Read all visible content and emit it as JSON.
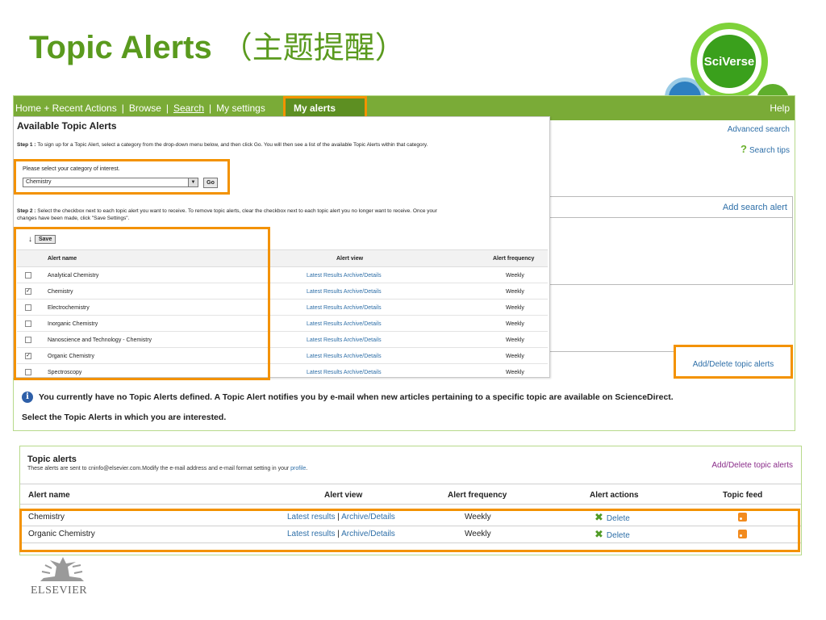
{
  "slide": {
    "title_en": "Topic Alerts",
    "title_cn": "（主题提醒）",
    "logo_text": "SciVerse",
    "publisher": "ELSEVIER"
  },
  "navbar": {
    "items": [
      "Home + Recent Actions",
      "Browse",
      "Search",
      "My settings"
    ],
    "active": "My alerts",
    "help": "Help"
  },
  "right_side": {
    "advanced_search": "Advanced search",
    "search_tips": "Search tips",
    "add_search_alert": "Add search alert",
    "add_delete_topic_alerts": "Add/Delete topic alerts"
  },
  "info": {
    "line1": "You currently have no Topic Alerts defined. A Topic Alert notifies you by e-mail when new articles pertaining to a specific topic are available on ScienceDirect.",
    "line2": "Select the Topic Alerts in which you are interested."
  },
  "panel": {
    "title": "Available Topic Alerts",
    "step1_label": "Step 1 :",
    "step1_text": "To sign up for a Topic Alert, select a category from the drop-down menu below, and then click Go. You will then see a list of the available Topic Alerts within that category.",
    "category_prompt": "Please select your category of interest.",
    "category_value": "Chemistry",
    "go": "Go",
    "step2_label": "Step 2 :",
    "step2_text": "Select the checkbox next to each topic alert you want to receive. To remove topic alerts, clear the checkbox next to each topic alert you no longer want to receive. Once your changes have been made, click \"Save Settings\".",
    "save": "Save",
    "columns": [
      "Alert name",
      "Alert view",
      "Alert frequency"
    ],
    "view_latest": "Latest Results",
    "view_archive": "Archive/Details",
    "rows": [
      {
        "name": "Analytical Chemistry",
        "checked": false,
        "freq": "Weekly"
      },
      {
        "name": "Chemistry",
        "checked": true,
        "freq": "Weekly"
      },
      {
        "name": "Electrochemistry",
        "checked": false,
        "freq": "Weekly"
      },
      {
        "name": "Inorganic Chemistry",
        "checked": false,
        "freq": "Weekly"
      },
      {
        "name": "Nanoscience and Technology - Chemistry",
        "checked": false,
        "freq": "Weekly"
      },
      {
        "name": "Organic Chemistry",
        "checked": true,
        "freq": "Weekly"
      },
      {
        "name": "Spectroscopy",
        "checked": false,
        "freq": "Weekly"
      }
    ]
  },
  "bottom": {
    "title": "Topic alerts",
    "subtitle": "These alerts are sent to cninfo@elsevier.com.Modify the e-mail address and e-mail format setting in your",
    "profile": "profile",
    "add_delete": "Add/Delete topic alerts",
    "columns": [
      "Alert name",
      "Alert view",
      "Alert frequency",
      "Alert actions",
      "Topic feed"
    ],
    "view_latest": "Latest results",
    "view_sep": "|",
    "view_archive": "Archive/Details",
    "delete": "Delete",
    "rows": [
      {
        "name": "Chemistry",
        "freq": "Weekly"
      },
      {
        "name": "Organic Chemistry",
        "freq": "Weekly"
      }
    ]
  },
  "colors": {
    "accent_green": "#5a9a1e",
    "nav_green": "#7aab37",
    "highlight_orange": "#f39200",
    "link_blue": "#2e6fa8"
  }
}
